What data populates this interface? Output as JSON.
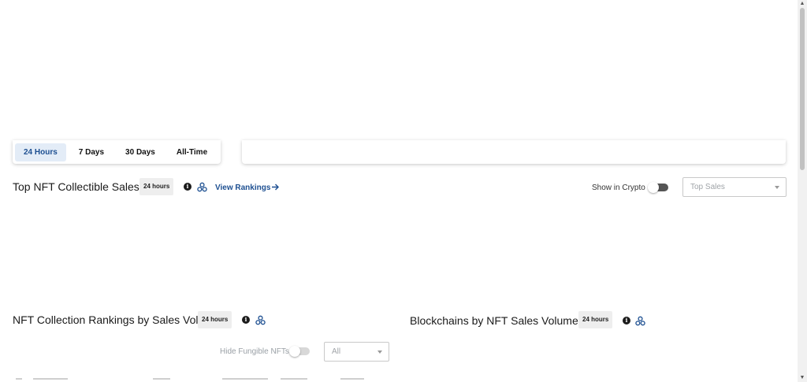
{
  "time_tabs": [
    {
      "label": "24 Hours",
      "active": true
    },
    {
      "label": "7 Days",
      "active": false
    },
    {
      "label": "30 Days",
      "active": false
    },
    {
      "label": "All-Time",
      "active": false
    }
  ],
  "top_sales": {
    "title": "Top NFT Collectible Sales",
    "badge": "24 hours",
    "view_rankings_label": "View Rankings",
    "show_crypto_label": "Show in Crypto",
    "sort_select_value": "Top Sales"
  },
  "collection_rankings": {
    "title": "NFT Collection Rankings by Sales Volume",
    "badge": "24 hours",
    "hide_fungible_label": "Hide Fungible NFTs",
    "filter_select_value": "All"
  },
  "blockchains": {
    "title": "Blockchains by NFT Sales Volume",
    "badge": "24 hours"
  },
  "icons": {
    "info": "info-icon",
    "chain": "blockchain-icon",
    "arrow": "arrow-right-icon"
  },
  "colors": {
    "accent": "#1d4f91",
    "active_tab_bg": "#e3ecf7"
  }
}
